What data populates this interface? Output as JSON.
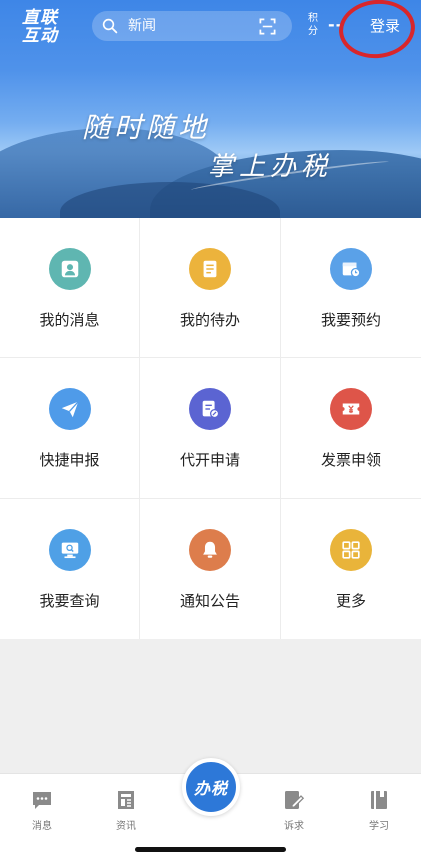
{
  "header": {
    "logo_line1": "直联",
    "logo_line2": "互动",
    "search_placeholder": "新闻",
    "points_label": "积分",
    "points_value": "--",
    "login_label": "登录"
  },
  "banner": {
    "slogan_line1": "随时随地",
    "slogan_line2": "掌上办税"
  },
  "services": [
    {
      "label": "我的消息",
      "icon": "person-icon",
      "color": "#5fb6b1"
    },
    {
      "label": "我的待办",
      "icon": "document-icon",
      "color": "#ecb33c"
    },
    {
      "label": "我要预约",
      "icon": "calendar-clock-icon",
      "color": "#5aa1e8"
    },
    {
      "label": "快捷申报",
      "icon": "paper-plane-icon",
      "color": "#4f9be9"
    },
    {
      "label": "代开申请",
      "icon": "invoice-edit-icon",
      "color": "#5b64d2"
    },
    {
      "label": "发票申领",
      "icon": "ticket-yuan-icon",
      "color": "#de5549"
    },
    {
      "label": "我要查询",
      "icon": "monitor-search-icon",
      "color": "#4fa0e6"
    },
    {
      "label": "通知公告",
      "icon": "bell-icon",
      "color": "#dd7d4c"
    },
    {
      "label": "更多",
      "icon": "grid-more-icon",
      "color": "#e9b43a"
    }
  ],
  "bottom_nav": {
    "items": [
      {
        "label": "消息",
        "icon": "chat-icon"
      },
      {
        "label": "资讯",
        "icon": "news-icon"
      },
      {
        "label": "诉求",
        "icon": "pen-icon"
      },
      {
        "label": "学习",
        "icon": "book-icon"
      }
    ],
    "center_label": "办税"
  },
  "colors": {
    "header_blue": "#3e86e7",
    "login_highlight": "#d8262b",
    "center_button": "#2d78d8"
  }
}
